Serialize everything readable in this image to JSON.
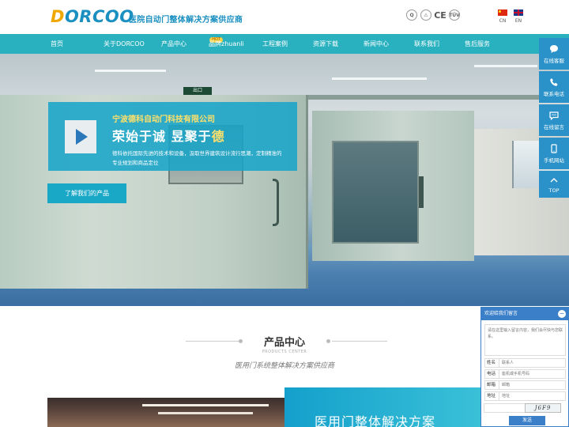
{
  "header": {
    "logo_lead": "D",
    "logo_rest": "ORCOO",
    "slogan": "医院自动门整体解决方案供应商",
    "certs": [
      "Q",
      "⚠",
      "CE",
      "TÜV"
    ],
    "languages": [
      {
        "code": "CN"
      },
      {
        "code": "EN"
      }
    ]
  },
  "nav": {
    "items": [
      {
        "label": "首页"
      },
      {
        "label": "关于DORCOO"
      },
      {
        "label": "产品中心",
        "badge": "HOT"
      },
      {
        "label": "品牌zhuanli"
      },
      {
        "label": "工程案例"
      },
      {
        "label": "资源下载"
      },
      {
        "label": "新闻中心"
      },
      {
        "label": "联系我们"
      },
      {
        "label": "售后服务"
      }
    ]
  },
  "hero": {
    "company": "宁波德科自动门科技有限公司",
    "headline_main": "荣始于诚 昱聚于",
    "headline_highlight": "德",
    "description": "德科依托国际先进的技术和设备，汲取世界建筑设计流行思潮，定制精准的专业规划和商品定位",
    "cta": "了解我们的产品",
    "sign_text": "出口"
  },
  "float_bar": {
    "items": [
      {
        "label": "在线客服",
        "icon": "chat-bubble-icon"
      },
      {
        "label": "联系电话",
        "icon": "phone-icon"
      },
      {
        "label": "在线留言",
        "icon": "message-icon"
      },
      {
        "label": "手机网站",
        "icon": "mobile-icon"
      },
      {
        "label": "TOP",
        "icon": "arrow-up-icon"
      }
    ]
  },
  "section": {
    "title": "产品中心",
    "subtitle": "PRODUCTS CENTER",
    "caption": "医用门系统整体解决方案供应商"
  },
  "promo": {
    "title": "医用门整体解决方案"
  },
  "message": {
    "header": "欢迎给我们留言",
    "minimize": "−",
    "textarea_placeholder": "请在这里输入留言内容，我们会尽快与您联系。",
    "fields": [
      {
        "label": "姓名",
        "placeholder": "联系人"
      },
      {
        "label": "电话",
        "placeholder": "座机或手机号码"
      },
      {
        "label": "邮箱",
        "placeholder": "邮箱"
      },
      {
        "label": "地址",
        "placeholder": "地址"
      }
    ],
    "captcha": "J6F9",
    "send": "发送"
  },
  "colors": {
    "brand_blue": "#1a8fc0",
    "brand_gold": "#f0a800",
    "nav_bg": "#2ab1bf",
    "float_bg": "#2a92c8",
    "msg_blue": "#3a7fc8"
  }
}
